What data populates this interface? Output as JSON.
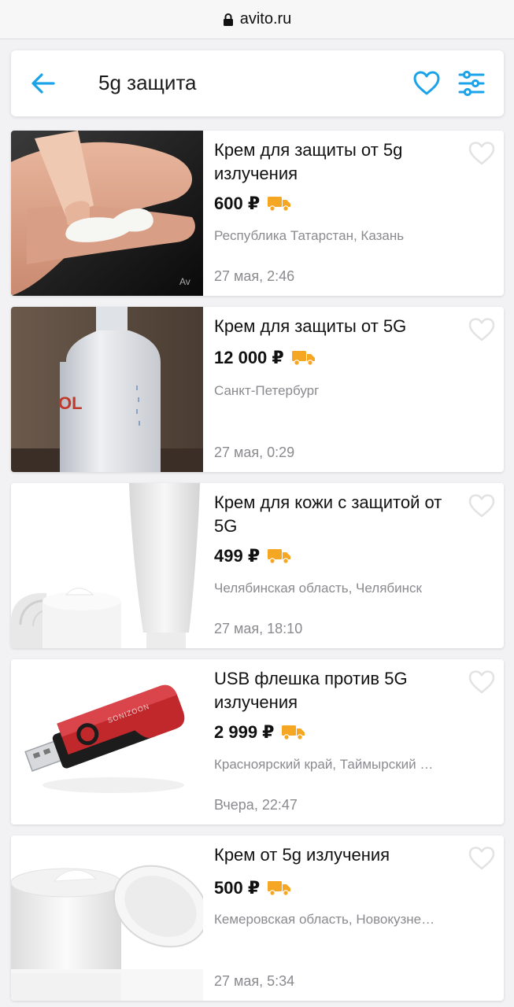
{
  "browser": {
    "domain": "avito.ru"
  },
  "search": {
    "query": "5g защита"
  },
  "colors": {
    "accent": "#1aa3e8",
    "delivery": "#f5a623",
    "muted": "#8a8a8f"
  },
  "listings": [
    {
      "title": "Крем для защиты от 5g излучения",
      "price": "600 ₽",
      "location": "Республика Татарстан, Казань",
      "date": "27 мая, 2:46",
      "watermark": "Av"
    },
    {
      "title": "Крем для защиты от 5G",
      "price": "12 000 ₽",
      "location": "Санкт-Петербург",
      "date": "27 мая, 0:29",
      "label_fragment": "OL"
    },
    {
      "title": "Крем для кожи с защитой от 5G",
      "price": "499 ₽",
      "location": "Челябинская область, Челябинск",
      "date": "27 мая, 18:10"
    },
    {
      "title": "USB флешка против 5G излучения",
      "price": "2 999 ₽",
      "location": "Красноярский край, Таймырский …",
      "date": "Вчера, 22:47",
      "brand": "SONIZOON"
    },
    {
      "title": "Крем от 5g излучения",
      "price": "500 ₽",
      "location": "Кемеровская область, Новокузне…",
      "date": "27 мая, 5:34"
    }
  ]
}
